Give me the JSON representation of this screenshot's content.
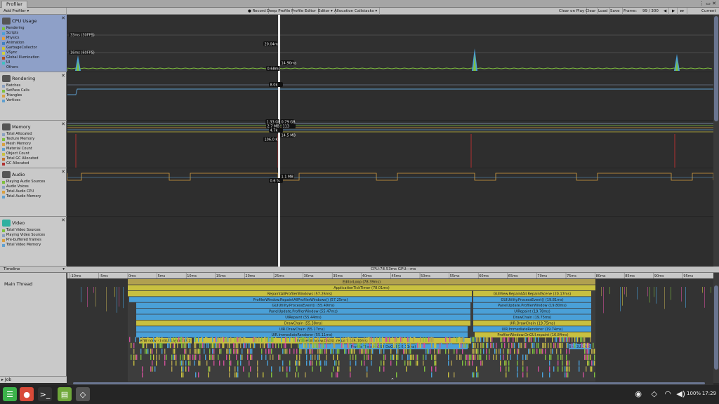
{
  "window": {
    "tab": "Profiler"
  },
  "toolbar": {
    "add_profiler": "Add Profiler",
    "record": "Record",
    "deep_profile": "Deep Profile",
    "profile_editor": "Profile Editor",
    "editor": "Editor",
    "allocation_callstacks": "Allocation Callstacks",
    "clear_on_play": "Clear on Play",
    "clear": "Clear",
    "load": "Load",
    "save": "Save",
    "frame_label": "Frame:",
    "frame_value": "99 / 300",
    "current": "Current"
  },
  "modules": [
    {
      "title": "CPU Usage",
      "selected": true,
      "icon": "cpu-icon",
      "legend": [
        {
          "label": "Rendering",
          "color": "#7fbf3f"
        },
        {
          "label": "Scripts",
          "color": "#4aa0d8"
        },
        {
          "label": "Physics",
          "color": "#e0a040"
        },
        {
          "label": "Animation",
          "color": "#3e80c0"
        },
        {
          "label": "GarbageCollector",
          "color": "#c8c040"
        },
        {
          "label": "VSync",
          "color": "#d0d040"
        },
        {
          "label": "Global Illumination",
          "color": "#b05020"
        },
        {
          "label": "UI",
          "color": "#40c0c0"
        },
        {
          "label": "Others",
          "color": "#9aa0b8"
        }
      ]
    },
    {
      "title": "Rendering",
      "selected": false,
      "icon": "rendering-icon",
      "legend": [
        {
          "label": "Batches",
          "color": "#8aa0c0"
        },
        {
          "label": "SetPass Calls",
          "color": "#7fbf3f"
        },
        {
          "label": "Triangles",
          "color": "#d8a040"
        },
        {
          "label": "Vertices",
          "color": "#5fa0d0"
        }
      ]
    },
    {
      "title": "Memory",
      "selected": false,
      "icon": "memory-icon",
      "legend": [
        {
          "label": "Total Allocated",
          "color": "#8aa0c0"
        },
        {
          "label": "Texture Memory",
          "color": "#7fbf3f"
        },
        {
          "label": "Mesh Memory",
          "color": "#d8a040"
        },
        {
          "label": "Material Count",
          "color": "#5fa0d0"
        },
        {
          "label": "Object Count",
          "color": "#c8c040"
        },
        {
          "label": "Total GC Allocated",
          "color": "#c07030"
        },
        {
          "label": "GC Allocated",
          "color": "#b03030"
        }
      ]
    },
    {
      "title": "Audio",
      "selected": false,
      "icon": "audio-icon",
      "legend": [
        {
          "label": "Playing Audio Sources",
          "color": "#7fbf3f"
        },
        {
          "label": "Audio Voices",
          "color": "#8aa0c0"
        },
        {
          "label": "Total Audio CPU",
          "color": "#d8a040"
        },
        {
          "label": "Total Audio Memory",
          "color": "#5fa0d0"
        }
      ]
    },
    {
      "title": "Video",
      "selected": false,
      "icon": "video-icon",
      "legend": [
        {
          "label": "Total Video Sources",
          "color": "#7fbf3f"
        },
        {
          "label": "Playing Video Sources",
          "color": "#8aa0c0"
        },
        {
          "label": "Pre-buffered frames",
          "color": "#d8a040"
        },
        {
          "label": "Total Video Memory",
          "color": "#5fa0d0"
        }
      ]
    }
  ],
  "cpu_graph": {
    "line_30fps": "33ms (30FPS)",
    "line_60fps": "16ms (60FPS)",
    "readout_top": "20.04ms",
    "readout_mid": "14.90ms",
    "readout_low": "0.68ms"
  },
  "rendering_graph": {
    "readout": "8.0k"
  },
  "memory_graph": {
    "readouts": [
      "1.33 GB",
      "0.79 GB",
      "2.7 MB",
      "113",
      "4.7k",
      "14.5 MB",
      "106.0 KB"
    ]
  },
  "audio_graph": {
    "readouts": [
      "1.1 MB",
      "0.6 %"
    ]
  },
  "timeline": {
    "view": "Timeline",
    "cpu_gpu": "CPU:78.53ms   GPU:--ms",
    "thread": "Main Thread",
    "job": "Job",
    "ticks": [
      "-10ms",
      "-5ms",
      "0ms",
      "5ms",
      "10ms",
      "15ms",
      "20ms",
      "25ms",
      "30ms",
      "35ms",
      "40ms",
      "45ms",
      "50ms",
      "55ms",
      "60ms",
      "65ms",
      "70ms",
      "75ms",
      "80ms",
      "85ms",
      "90ms",
      "95ms"
    ],
    "bars": [
      {
        "label": "EditorLoop (78.39ms)",
        "color": "#b0a050"
      },
      {
        "label": "ApplicationTickTimer (78.01ms)",
        "color": "#c8c040"
      },
      {
        "label": "RepaintAllProfilerWindows (57.26ms)",
        "color": "#c8c040"
      },
      {
        "label": "ProfilerWindow.RepaintAllProfilerWindows() (57.25ms)",
        "color": "#4aa0d8"
      },
      {
        "label": "GUIUtility.ProcessEvent() (55.49ms)",
        "color": "#4aa0d8"
      },
      {
        "label": "PanelUpdate.ProfilerWindow (55.47ms)",
        "color": "#4aa0d8"
      },
      {
        "label": "UIRepaint (55.44ms)",
        "color": "#4aa0d8"
      },
      {
        "label": "DrawChain (55.38ms)",
        "color": "#c8c040"
      },
      {
        "label": "UIR.DrawChain (55.17ms)",
        "color": "#4aa0d8"
      },
      {
        "label": "UIR.ImmediateRenderer (55.11ms)",
        "color": "#4aa0d8"
      },
      {
        "label": "ProfilerWindow.OnGUI.repaint (45.00ms)",
        "color": "#c8c040"
      },
      {
        "label": "ProfilerTimelineGUI.DoGUI (26.11ms)",
        "color": "#4aa0d8"
      },
      {
        "label": "erWindow.OnGUI.Layout (8.2",
        "color": "#c8c040"
      },
      {
        "label": "GUIView.RepaintAll.RepaintScene (20.17ms)",
        "color": "#c8c040"
      },
      {
        "label": "GUIUtility.ProcessEvent() (19.81ms)",
        "color": "#4aa0d8"
      },
      {
        "label": "PanelUpdate.ProfilerWindow (19.80ms)",
        "color": "#4aa0d8"
      },
      {
        "label": "UIRepaint (19.78ms)",
        "color": "#4aa0d8"
      },
      {
        "label": "DrawChain (19.75ms)",
        "color": "#4aa0d8"
      },
      {
        "label": "UIR.DrawChain (19.75ms)",
        "color": "#c8c040"
      },
      {
        "label": "UIR.ImmediateRenderer (19.74ms)",
        "color": "#4aa0d8"
      },
      {
        "label": "ProfilerWindow.OnGUI.repaint (16.84ms)",
        "color": "#c8c040"
      },
      {
        "label": "lineGUI.DoG",
        "color": "#4aa0d8"
      }
    ]
  },
  "taskbar": {
    "apps": [
      {
        "name": "menu-icon",
        "color": "#3cb24a"
      },
      {
        "name": "chrome-icon",
        "color": "#d84a38"
      },
      {
        "name": "terminal-icon",
        "color": "#333333"
      },
      {
        "name": "files-icon",
        "color": "#6fa83a"
      },
      {
        "name": "unity-icon",
        "color": "#555555"
      }
    ],
    "app_glyphs": [
      "☰",
      "●",
      ">_",
      "▤",
      "◇"
    ],
    "battery": "100%",
    "clock": "17:29"
  }
}
